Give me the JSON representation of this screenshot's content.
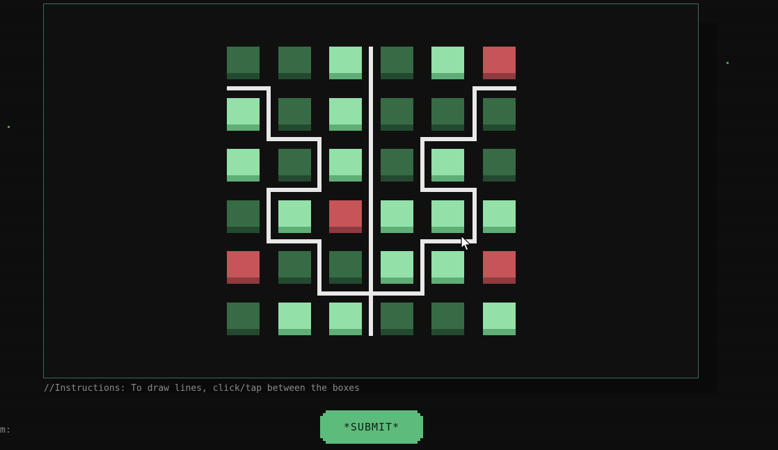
{
  "board": {
    "rows": [
      [
        "dark",
        "dark",
        "light",
        "dark",
        "light",
        "red"
      ],
      [
        "light",
        "dark",
        "light",
        "dark",
        "dark",
        "dark"
      ],
      [
        "light",
        "dark",
        "light",
        "dark",
        "light",
        "dark"
      ],
      [
        "dark",
        "light",
        "red",
        "light",
        "light",
        "light"
      ],
      [
        "red",
        "dark",
        "dark",
        "light",
        "light",
        "red"
      ],
      [
        "dark",
        "light",
        "light",
        "dark",
        "dark",
        "light"
      ]
    ],
    "colors": {
      "dark": "#376b45",
      "light": "#93e0a8",
      "red": "#c65458",
      "line": "#e8e8e8",
      "border": "#3f6b54"
    }
  },
  "instructions": "//Instructions: To draw lines, click/tap between the boxes",
  "submit_label": "*SUBMIT*",
  "edge_label": "m:"
}
